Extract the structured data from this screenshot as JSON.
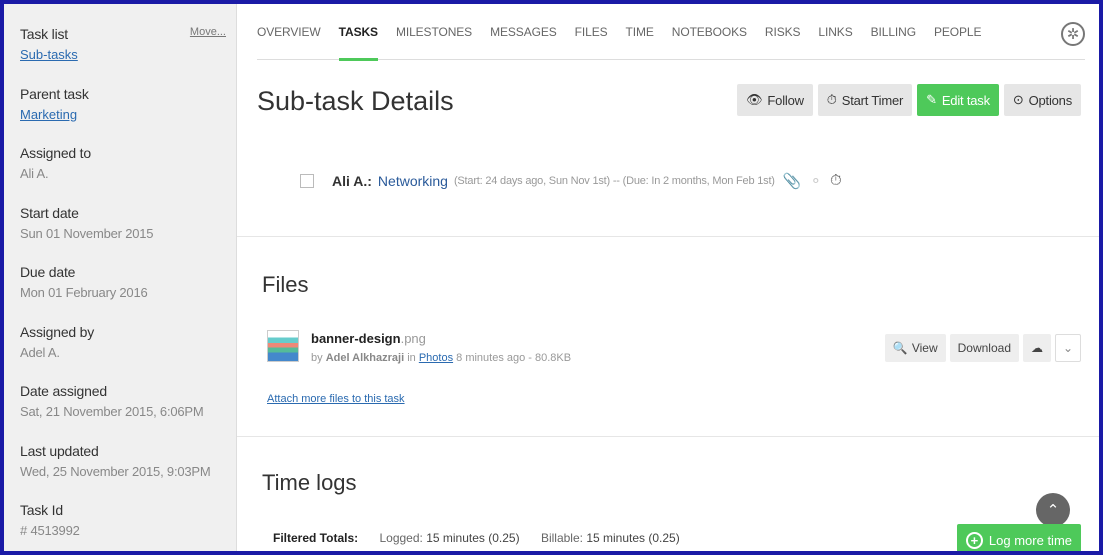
{
  "sidebar": {
    "move_label": "Move...",
    "fields": [
      {
        "label": "Task list",
        "value": "Sub-tasks"
      },
      {
        "label": "Parent task",
        "value": "Marketing"
      },
      {
        "label": "Assigned to",
        "value": "Ali A."
      },
      {
        "label": "Start date",
        "value": "Sun 01 November 2015"
      },
      {
        "label": "Due date",
        "value": "Mon 01 February 2016"
      },
      {
        "label": "Assigned by",
        "value": "Adel A."
      },
      {
        "label": "Date assigned",
        "value": "Sat, 21 November 2015, 6:06PM"
      },
      {
        "label": "Last updated",
        "value": "Wed, 25 November 2015, 9:03PM"
      },
      {
        "label": "Task Id",
        "value": "# 4513992"
      }
    ]
  },
  "nav": {
    "tabs": [
      "OVERVIEW",
      "TASKS",
      "MILESTONES",
      "MESSAGES",
      "FILES",
      "TIME",
      "NOTEBOOKS",
      "RISKS",
      "LINKS",
      "BILLING",
      "PEOPLE"
    ],
    "active": "TASKS"
  },
  "header": {
    "title": "Sub-task Details",
    "follow_label": "Follow",
    "start_timer_label": "Start Timer",
    "edit_task_label": "Edit task",
    "options_label": "Options"
  },
  "task": {
    "assignee": "Ali A.:",
    "name": "Networking",
    "dates": "(Start: 24 days ago, Sun Nov 1st) -- (Due: In 2 months, Mon Feb 1st)"
  },
  "files": {
    "title": "Files",
    "items": [
      {
        "name": "banner-design",
        "ext": ".png",
        "by_prefix": "by",
        "author": "Adel Alkhazraji",
        "in_word": "in",
        "location": "Photos",
        "meta_suffix": "8 minutes ago - 80.8KB"
      }
    ],
    "view_label": "View",
    "download_label": "Download",
    "attach_label": "Attach more files to this task"
  },
  "timelogs": {
    "title": "Time logs",
    "filtered_totals_label": "Filtered Totals:",
    "logged_label": "Logged:",
    "logged_value": "15 minutes (0.25)",
    "billable_label": "Billable:",
    "billable_value": "15 minutes (0.25)",
    "log_more_label": "Log more time"
  },
  "colors": {
    "accent_green": "#4ec95a",
    "link_blue": "#2a6ab0",
    "frame_blue": "#1a1aa6"
  }
}
